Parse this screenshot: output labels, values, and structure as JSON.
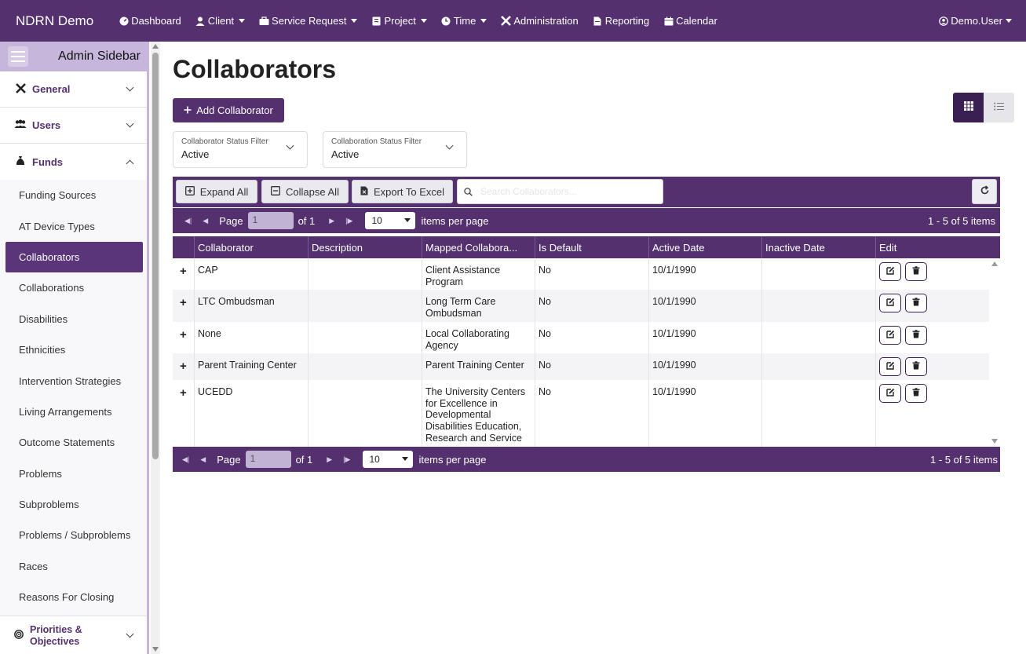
{
  "nav": {
    "brand": "NDRN Demo",
    "items": [
      {
        "label": "Dashboard",
        "icon": "dashboard-icon",
        "caret": false
      },
      {
        "label": "Client",
        "icon": "person-icon",
        "caret": true
      },
      {
        "label": "Service Request",
        "icon": "briefcase-icon",
        "caret": true
      },
      {
        "label": "Project",
        "icon": "clipboard-icon",
        "caret": true
      },
      {
        "label": "Time",
        "icon": "clock-icon",
        "caret": true
      },
      {
        "label": "Administration",
        "icon": "tools-icon",
        "caret": false
      },
      {
        "label": "Reporting",
        "icon": "file-icon",
        "caret": false
      },
      {
        "label": "Calendar",
        "icon": "calendar-icon",
        "caret": false
      }
    ],
    "user": "Demo.User"
  },
  "sidebar": {
    "title": "Admin Sidebar",
    "sections": [
      {
        "label": "General",
        "icon": "tools-icon"
      },
      {
        "label": "Users",
        "icon": "users-icon"
      },
      {
        "label": "Funds",
        "icon": "money-bag-icon"
      }
    ],
    "items": [
      "Funding Sources",
      "AT Device Types",
      "Collaborators",
      "Collaborations",
      "Disabilities",
      "Ethnicities",
      "Intervention Strategies",
      "Living Arrangements",
      "Outcome Statements",
      "Problems",
      "Subproblems",
      "Problems / Subproblems",
      "Races",
      "Reasons For Closing"
    ],
    "active_item": "Collaborators",
    "bottom_section": {
      "line1": "Priorities &",
      "line2": "Objectives"
    }
  },
  "main": {
    "title": "Collaborators",
    "add_button": "Add Collaborator",
    "filters": [
      {
        "label": "Collaborator Status Filter",
        "value": "Active"
      },
      {
        "label": "Collaboration Status Filter",
        "value": "Active"
      }
    ]
  },
  "grid": {
    "toolbar": {
      "expand_all": "Expand All",
      "collapse_all": "Collapse All",
      "export": "Export To Excel",
      "search_placeholder": "Search Collaborators..."
    },
    "pager": {
      "page_label": "Page",
      "page_value": "1",
      "of_label": "of 1",
      "page_size": "10",
      "per_page_label": "items per page",
      "count_label": "1 - 5 of 5 items"
    },
    "columns": [
      "Collaborator",
      "Description",
      "Mapped Collabora...",
      "Is Default",
      "Active Date",
      "Inactive Date",
      "Edit"
    ],
    "rows": [
      {
        "collaborator": "CAP",
        "description": "",
        "mapped": "Client Assistance Program",
        "is_default": "No",
        "active_date": "10/1/1990",
        "inactive_date": ""
      },
      {
        "collaborator": "LTC Ombudsman",
        "description": "",
        "mapped": "Long Term Care Ombudsman",
        "is_default": "No",
        "active_date": "10/1/1990",
        "inactive_date": ""
      },
      {
        "collaborator": "None",
        "description": "",
        "mapped": "Local Collaborating Agency",
        "is_default": "No",
        "active_date": "10/1/1990",
        "inactive_date": ""
      },
      {
        "collaborator": "Parent Training Center",
        "description": "",
        "mapped": "Parent Training Center",
        "is_default": "No",
        "active_date": "10/1/1990",
        "inactive_date": ""
      },
      {
        "collaborator": "UCEDD",
        "description": "",
        "mapped": "The University Centers for Excellence in Developmental Disabilities Education, Research and Service",
        "is_default": "No",
        "active_date": "10/1/1990",
        "inactive_date": ""
      }
    ]
  },
  "colors": {
    "primary": "#54306f",
    "sidebar_header": "#c6b6dc"
  }
}
